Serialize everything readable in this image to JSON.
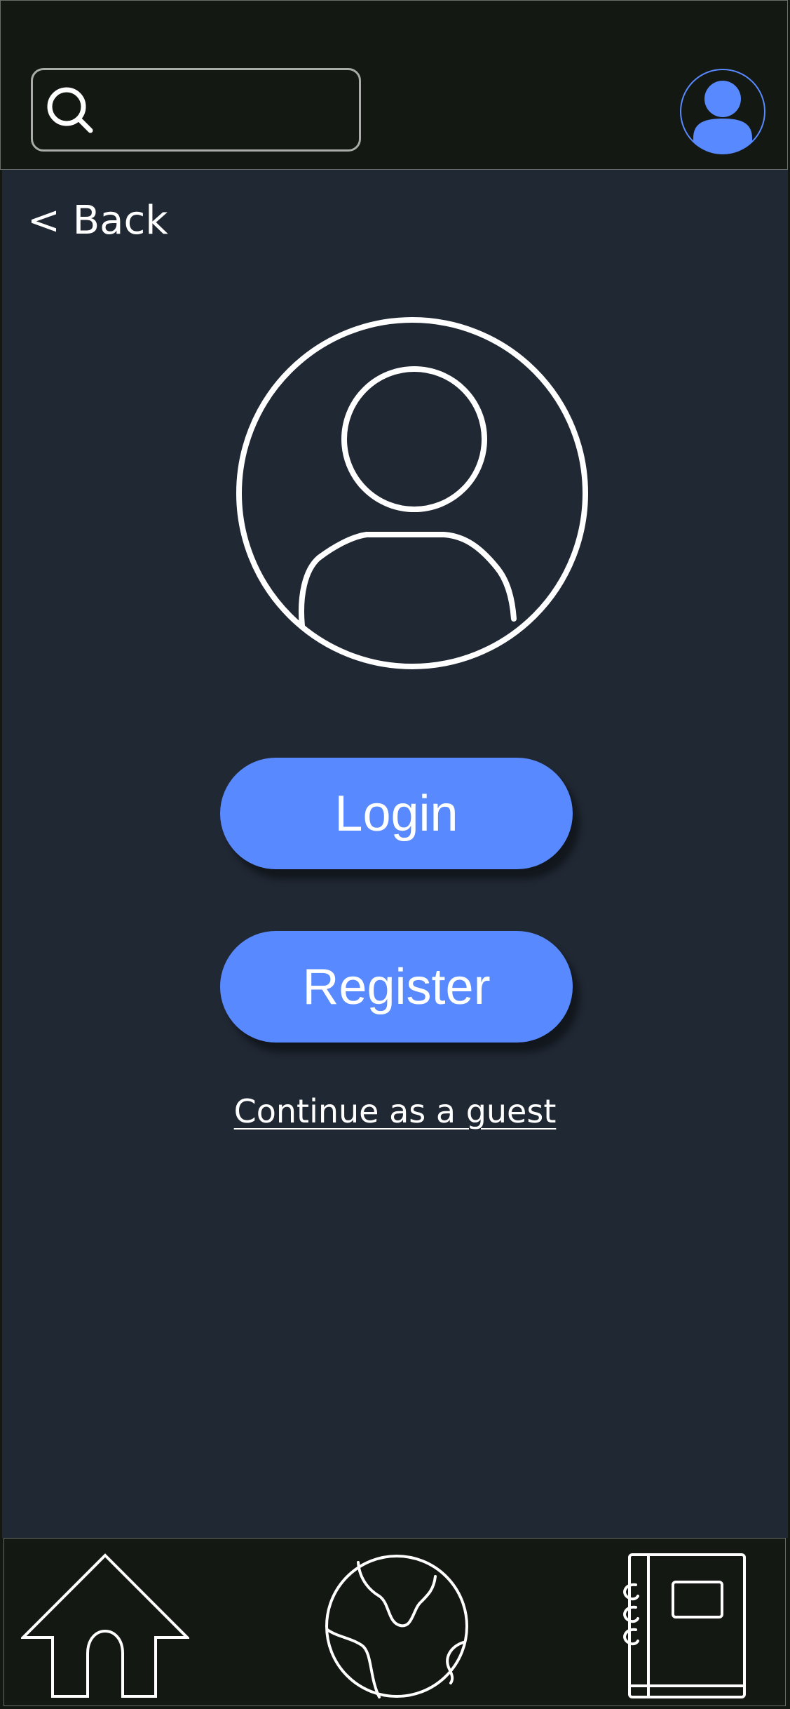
{
  "header": {
    "search": {
      "value": "",
      "placeholder": ""
    },
    "icons": {
      "search": "search-icon",
      "profile": "user-avatar-icon"
    }
  },
  "main": {
    "back_label": "< Back",
    "login_label": "Login",
    "register_label": "Register",
    "guest_label": "Continue as a guest",
    "illustration_icon": "user-profile-icon"
  },
  "bottom_nav": {
    "items": [
      {
        "icon": "home-icon"
      },
      {
        "icon": "globe-icon"
      },
      {
        "icon": "notebook-icon"
      }
    ]
  },
  "colors": {
    "header_bg": "#141812",
    "main_bg": "#202834",
    "accent": "#5889fe",
    "text": "#ffffff",
    "border": "#6b6e6a"
  }
}
